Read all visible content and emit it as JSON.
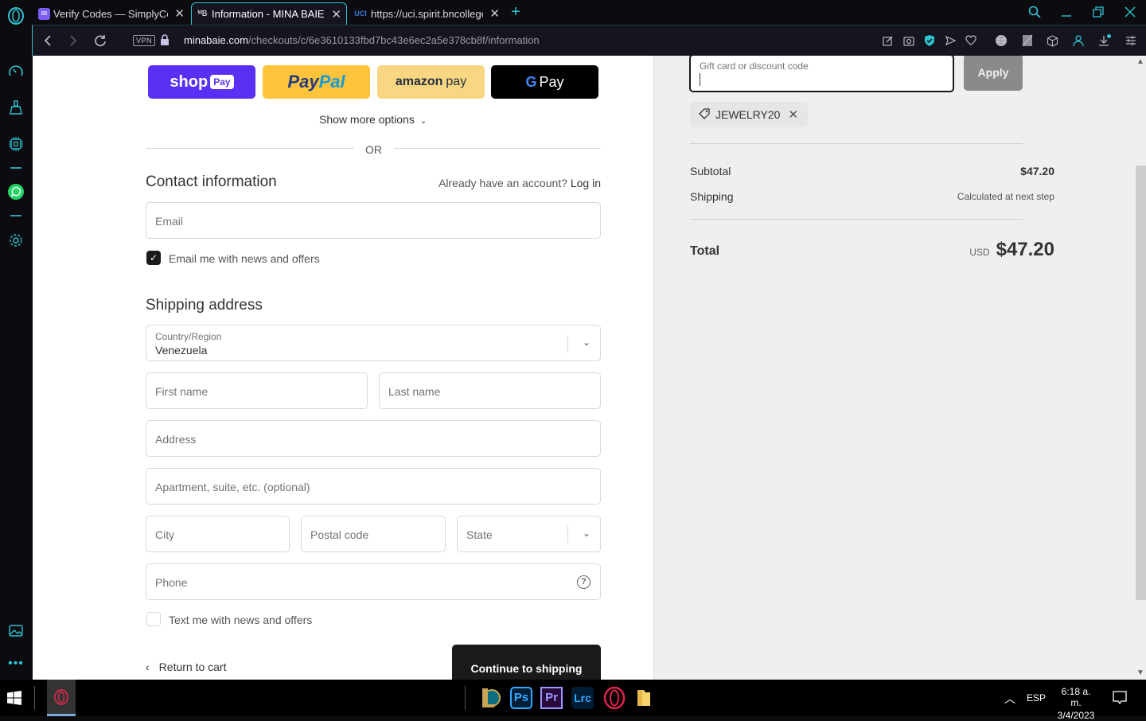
{
  "browser": {
    "tabs": [
      {
        "title": "Verify Codes — SimplyCodes",
        "favicon": "simplycodes-icon",
        "active": false
      },
      {
        "title": "Information - MINA BAIE - Checkout",
        "favicon": "mb-logo-icon",
        "active": true
      },
      {
        "title": "https://uci.spirit.bncollege.com",
        "favicon": "uci-icon",
        "active": false
      }
    ],
    "new_tab_label": "+",
    "url_domain": "minabaie.com",
    "url_path": "/checkouts/c/6e3610133fbd7bc43e6ec2a5e378cb8f/information",
    "vpn_label": "VPN",
    "accent": "#2ec4d2"
  },
  "express_checkout": {
    "shop_pay": {
      "word": "shop",
      "chip": "Pay"
    },
    "paypal": {
      "part1": "Pay",
      "part2": "Pal"
    },
    "amazon_pay": {
      "word": "amazon",
      "suffix": "pay"
    },
    "google_pay": {
      "g": "G",
      "word": "Pay"
    },
    "show_more": "Show more options",
    "divider": "OR"
  },
  "contact": {
    "heading": "Contact information",
    "account_prompt": "Already have an account?",
    "login_link": "Log in",
    "email_placeholder": "Email",
    "email_opt_in": {
      "label": "Email me with news and offers",
      "checked": true
    }
  },
  "shipping": {
    "heading": "Shipping address",
    "country_label": "Country/Region",
    "country_value": "Venezuela",
    "first_name_placeholder": "First name",
    "last_name_placeholder": "Last name",
    "address_placeholder": "Address",
    "apartment_placeholder": "Apartment, suite, etc. (optional)",
    "city_placeholder": "City",
    "postal_placeholder": "Postal code",
    "state_placeholder": "State",
    "phone_placeholder": "Phone",
    "sms_opt_in": {
      "label": "Text me with news and offers",
      "checked": false
    }
  },
  "actions": {
    "return_label": "Return to cart",
    "continue_label": "Continue to shipping"
  },
  "summary": {
    "gift_placeholder": "Gift card or discount code",
    "apply_label": "Apply",
    "discount_code": "JEWELRY20",
    "subtotal_label": "Subtotal",
    "subtotal_value": "$47.20",
    "shipping_label": "Shipping",
    "shipping_value": "Calculated at next step",
    "total_label": "Total",
    "currency": "USD",
    "total_value": "$47.20"
  },
  "taskbar": {
    "apps": [
      "start-icon",
      "opera-icon",
      "league-of-legends-icon",
      "photoshop-icon",
      "premiere-icon",
      "lightroom-classic-icon",
      "opera-gx-icon",
      "file-explorer-icon"
    ],
    "ps_label": "Ps",
    "pr_label": "Pr",
    "lrc_label": "Lrc",
    "language": "ESP",
    "time": "6:18 a. m.",
    "date": "3/4/2023"
  }
}
